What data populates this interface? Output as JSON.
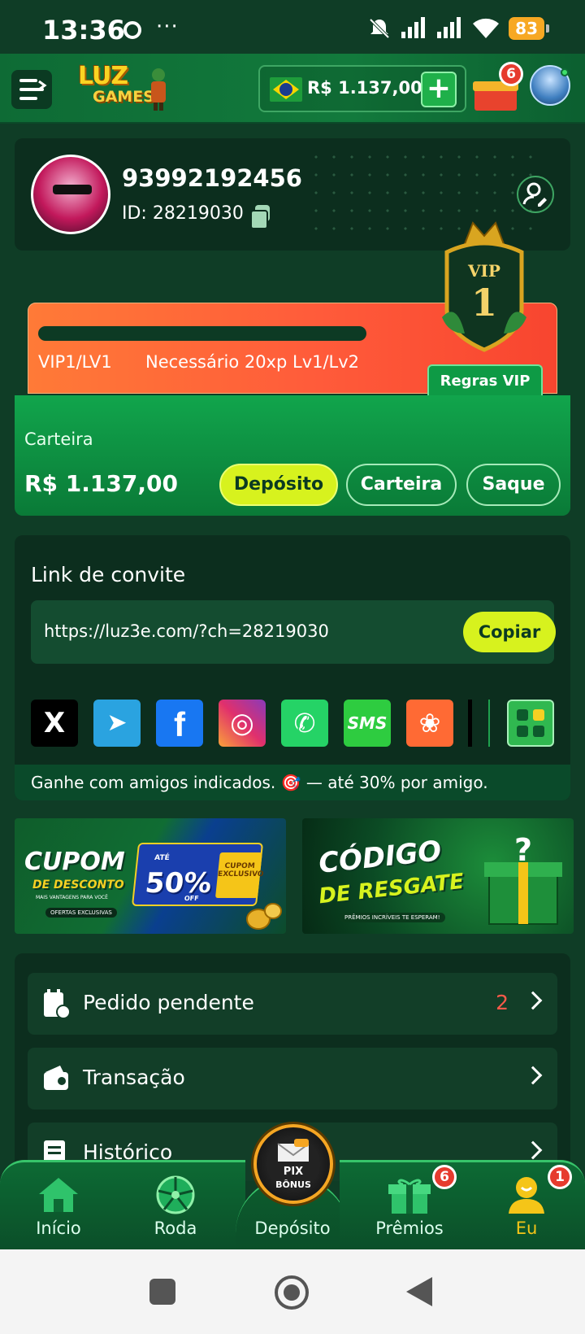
{
  "status_bar": {
    "time": "13:36",
    "dots": "···",
    "battery": "83"
  },
  "header": {
    "logo_line1": "LUZ",
    "logo_line2": "GAMES",
    "balance": "R$ 1.137,00",
    "plus": "+",
    "gift_badge": "6"
  },
  "profile": {
    "username": "93992192456",
    "id_text": "ID: 28219030"
  },
  "vip": {
    "level": "VIP1/LV1",
    "requirement": "Necessário 20xp Lv1/Lv2",
    "rules_button": "Regras VIP",
    "badge_title": "VIP",
    "badge_number": "1",
    "progress": 0
  },
  "wallet": {
    "label": "Carteira",
    "amount": "R$ 1.137,00",
    "deposit_button": "Depósito",
    "wallet_button": "Carteira",
    "withdraw_button": "Saque"
  },
  "invite": {
    "title": "Link de convite",
    "url": "https://luz3e.com/?ch=28219030",
    "copy_button": "Copiar",
    "share": [
      {
        "name": "x-icon",
        "glyph": "X",
        "color": "#000000"
      },
      {
        "name": "telegram-icon",
        "glyph": "➤",
        "color": "#2aa3e0"
      },
      {
        "name": "facebook-icon",
        "glyph": "f",
        "color": "#1877f2"
      },
      {
        "name": "instagram-icon",
        "glyph": "◎",
        "color": "#e1306c"
      },
      {
        "name": "whatsapp-icon",
        "glyph": "✆",
        "color": "#25d366"
      },
      {
        "name": "sms-icon",
        "glyph": "SMS",
        "color": "#2ecc40"
      },
      {
        "name": "kwai-icon",
        "glyph": "❀",
        "color": "#ff6a34"
      }
    ],
    "footer": "Ganhe com amigos indicados. 🎯 — até 30% por amigo."
  },
  "banners": {
    "coupon_title": "CUPOM",
    "coupon_sub": "DE DESCONTO",
    "coupon_small": "MAIS VANTAGENS PARA VOCÊ",
    "coupon_offers": "OFERTAS EXCLUSIVAS",
    "coupon_ate": "ATÉ",
    "coupon_percent": "50%",
    "coupon_off": "OFF",
    "coupon_exclusive": "CUPOM EXCLUSIVO",
    "code_title": "CÓDIGO",
    "code_sub": "DE RESGATE",
    "code_small": "PRÊMIOS INCRÍVEIS TE ESPERAM!"
  },
  "menu": [
    {
      "label": "Pedido pendente",
      "count": "2"
    },
    {
      "label": "Transação",
      "count": ""
    },
    {
      "label": "Histórico",
      "count": ""
    }
  ],
  "bottom_nav": {
    "home": "Início",
    "wheel": "Roda",
    "deposit": "Depósito",
    "prizes": "Prêmios",
    "me": "Eu",
    "pix_line1": "PIX",
    "pix_line2": "BÔNUS",
    "prizes_badge": "6",
    "me_badge": "1"
  },
  "colors": {
    "background": "#0f3d26",
    "accent_lime": "#d7f21e",
    "vip_orange": "#ff5b3a",
    "active_nav": "#f5c518"
  }
}
